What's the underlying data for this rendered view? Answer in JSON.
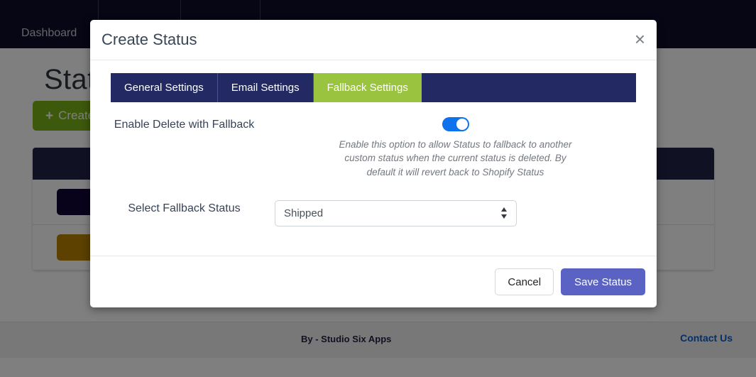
{
  "background": {
    "navbar": {
      "items": [
        {
          "label": "Dashboard"
        }
      ]
    },
    "page_title": "Status",
    "create_button": {
      "icon": "plus-icon",
      "plus": "+",
      "label": "Create Status"
    },
    "table": {
      "rows": [
        {
          "swatch_color": "#130536"
        },
        {
          "swatch_color": "#b98200"
        }
      ]
    },
    "footer": {
      "credit": "By - Studio Six Apps",
      "contact_link": "Contact Us"
    }
  },
  "modal": {
    "title": "Create Status",
    "close_icon": "×",
    "tabs": [
      {
        "label": "General Settings",
        "active": false
      },
      {
        "label": "Email Settings",
        "active": false
      },
      {
        "label": "Fallback Settings",
        "active": true
      }
    ],
    "fields": {
      "enable_fallback": {
        "label": "Enable Delete with Fallback",
        "toggle_state": "on",
        "help_text": "Enable this option to allow Status to fallback to another custom status when the current status is deleted. By default it will revert back to Shopify Status"
      },
      "select_fallback": {
        "label": "Select Fallback Status",
        "value": "Shipped",
        "options": [
          "Shipped"
        ]
      }
    },
    "footer": {
      "cancel_label": "Cancel",
      "save_label": "Save Status"
    }
  },
  "colors": {
    "navbar_bg": "#0d0d2b",
    "tabbar_bg": "#232a63",
    "tab_active_bg": "#9ac43f",
    "create_btn_bg": "#7ab317",
    "toggle_on": "#0d72ec",
    "save_btn_bg": "#5a62c4",
    "link_blue": "#0b5fd0"
  }
}
